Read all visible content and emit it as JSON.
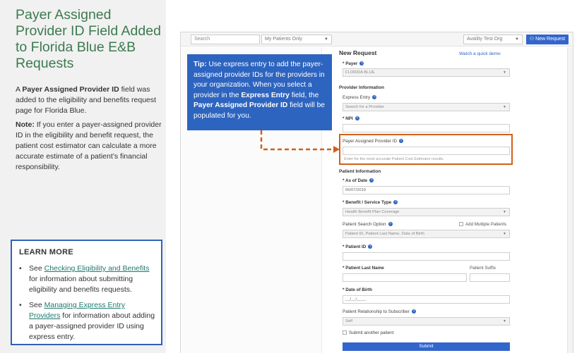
{
  "left": {
    "title": "Payer Assigned Provider ID Field Added to Florida Blue E&B Requests",
    "para1_prefix": "A ",
    "para1_bold": "Payer Assigned Provider ID",
    "para1_suffix": " field was added to the eligibility and benefits request page for Florida Blue.",
    "para2_bold": "Note:",
    "para2_text": " If you enter a payer-assigned provider ID in the eligibility and benefit request, the patient cost estimator can calculate a more accurate estimate of a patient’s financial responsibility."
  },
  "learn_more": {
    "heading": "LEARN MORE",
    "bullet": "•",
    "item1_prefix": "See ",
    "item1_link": "Checking Eligibility and Benefits",
    "item1_suffix": " for information about submitting eligibility and benefits requests.",
    "item2_prefix": "See ",
    "item2_link": "Managing Express Entry Providers",
    "item2_suffix": " for information about adding a payer-assigned provider ID using express entry."
  },
  "topbar": {
    "search_placeholder": "Search",
    "patients_filter": "My Patients Only",
    "org": "Availity Test Org",
    "new_request": "New Request"
  },
  "tip": {
    "label": "Tip:",
    "text1": " Use express entry to add the payer-assigned provider IDs for the providers in your organization. When you select a provider in the ",
    "bold1": "Express Entry",
    "text2": " field, the ",
    "bold2": "Payer Assigned Provider ID",
    "text3": " field will be populated for you."
  },
  "form": {
    "title": "New Request",
    "watch_link": "Watch a quick demo",
    "payer_label": "* Payer",
    "payer_value": "FLORIDA BLUE",
    "provider_section": "Provider Information",
    "express_entry_label": "Express Entry",
    "express_entry_placeholder": "Search for a Provider",
    "npi_label": "* NPI",
    "payer_provider_id_label": "Payer Assigned Provider ID",
    "payer_provider_id_hint": "Enter for the most accurate Patient Cost Estimator results.",
    "patient_section": "Patient Information",
    "as_of_date_label": "* As of Date",
    "as_of_date_value": "06/07/2019",
    "benefit_label": "* Benefit / Service Type",
    "benefit_value": "Health Benefit Plan Coverage",
    "search_option_label": "Patient Search Option",
    "add_multiple_label": "Add Multiple Patients",
    "search_option_value": "Patient ID, Patient Last Name, Date of Birth",
    "patient_id_label": "* Patient ID",
    "last_name_label": "* Patient Last Name",
    "suffix_label": "Patient Suffix",
    "dob_label": "* Date of Birth",
    "dob_placeholder": "__/__/____",
    "relationship_label": "Patient Relationship to Subscriber",
    "relationship_value": "Self",
    "submit_another_label": "Submit another patient",
    "submit_label": "Submit"
  },
  "colors": {
    "title_green": "#3d7a4f",
    "tip_blue": "#2d64c0",
    "highlight_orange": "#d0601a",
    "link_teal": "#1f7a6e"
  }
}
